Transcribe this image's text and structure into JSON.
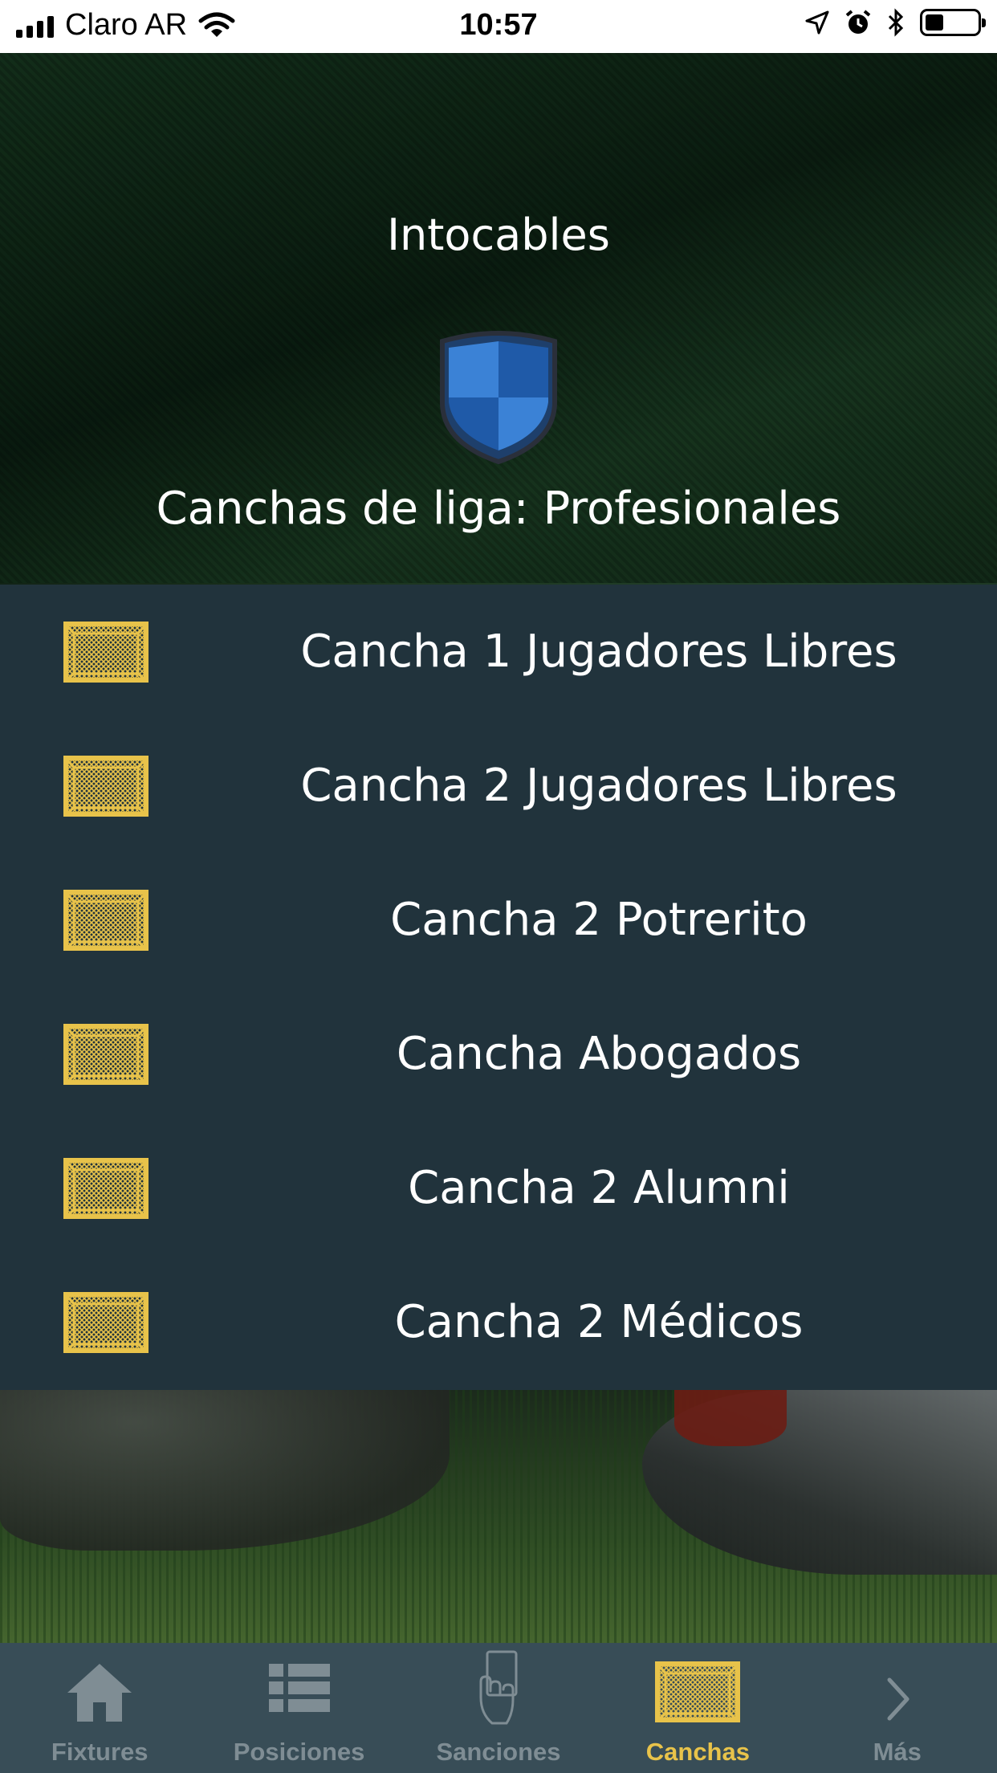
{
  "status_bar": {
    "carrier": "Claro AR",
    "time": "10:57",
    "battery_level": 0.35
  },
  "header": {
    "team_name": "Intocables",
    "league_line": "Canchas de liga: Profesionales",
    "shield_colors": [
      "#3b82d6",
      "#1f5aa8"
    ]
  },
  "courts": [
    {
      "label": "Cancha 1 Jugadores Libres"
    },
    {
      "label": "Cancha 2 Jugadores Libres"
    },
    {
      "label": "Cancha 2 Potrerito"
    },
    {
      "label": "Cancha Abogados"
    },
    {
      "label": "Cancha 2 Alumni"
    },
    {
      "label": "Cancha 2 Médicos"
    }
  ],
  "tabs": [
    {
      "label": "Fixtures",
      "icon": "home-icon",
      "active": false
    },
    {
      "label": "Posiciones",
      "icon": "list-icon",
      "active": false
    },
    {
      "label": "Sanciones",
      "icon": "card-hand-icon",
      "active": false
    },
    {
      "label": "Canchas",
      "icon": "goal-icon",
      "active": true
    },
    {
      "label": "Más",
      "icon": "chevron-right-icon",
      "active": false
    }
  ],
  "colors": {
    "accent": "#e8c34a",
    "list_bg": "#21333c",
    "tab_bar_bg": "#384d57",
    "tab_inactive": "#7f8d94"
  }
}
